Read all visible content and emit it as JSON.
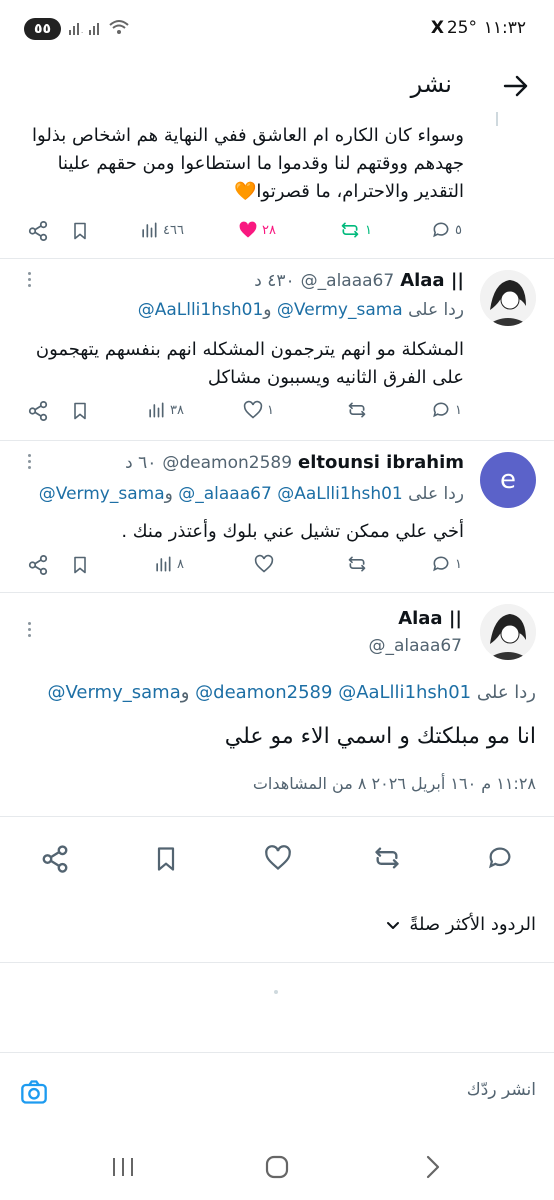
{
  "status_bar": {
    "time": "١١:٣٢",
    "temperature": "25°",
    "x_logo": "X",
    "battery": "٥٥"
  },
  "header": {
    "title": "نشر"
  },
  "tweet_top": {
    "text_lines": [
      "وسواء كان الكاره ام العاشق ففي النهاية هم اشخاص بذلوا",
      "جهدهم ووقتهم لنا وقدموا ما استطاعوا ومن حقهم علينا",
      "التقدير والاحترام، ما قصرتوا🧡"
    ],
    "replies": "٥",
    "reposts": "١",
    "likes": "٢٨",
    "views": "٤٦٦"
  },
  "reply1": {
    "name": "Alaa ||",
    "handle": "@_alaaa67",
    "time": "٤٣٠ د",
    "reply_to_prefix": "ردا على",
    "reply_to_1": "@Vermy_sama",
    "reply_to_and": "و",
    "reply_to_2": "@AaLlli1hsh01",
    "text_lines": [
      "المشكلة مو انهم يترجمون المشكله انهم بنفسهم يتهجمون",
      "على الفرق الثانيه ويسببون مشاكل"
    ],
    "replies": "١",
    "likes": "١",
    "views": "٣٨"
  },
  "reply2": {
    "avatar_letter": "e",
    "name": "eltounsi ibrahim",
    "handle": "@deamon2589",
    "time": "٦٠ د",
    "reply_to_prefix": "ردا على",
    "reply_to_1": "@AaLlli1hsh01",
    "reply_to_2": "@_alaaa67",
    "reply_to_and": "و",
    "reply_to_3": "@Vermy_sama",
    "text": "أخي علي ممكن تشيل عني بلوك وأعتذر منك .",
    "replies": "١",
    "views": "٨"
  },
  "main_tweet": {
    "name": "Alaa ||",
    "handle": "@_alaaa67",
    "reply_to_prefix": "ردا على",
    "reply_to_1": "@AaLlli1hsh01",
    "reply_to_2": "@deamon2589",
    "reply_to_and": "و",
    "reply_to_3": "@Vermy_sama",
    "text": "انا مو مبلكتك و اسمي الاء مو علي",
    "timestamp": "١١:٢٨ م ١٦٠ أبريل ٢٠٢٦ ٨ من المشاهدات"
  },
  "sort": {
    "label": "الردود الأكثر صلةً"
  },
  "composer": {
    "placeholder": "انشر ردّك"
  },
  "icons": {
    "back": "arrow-right-icon",
    "reply": "speech-bubble-icon",
    "repost": "repost-icon",
    "like": "heart-icon",
    "views": "bar-chart-icon",
    "bookmark": "bookmark-icon",
    "share": "share-icon",
    "camera": "camera-icon"
  },
  "colors": {
    "accent": "#1d9bf0",
    "like_active": "#f91880",
    "repost_active": "#00ba7c",
    "avatar_e": "#5b62c9"
  }
}
